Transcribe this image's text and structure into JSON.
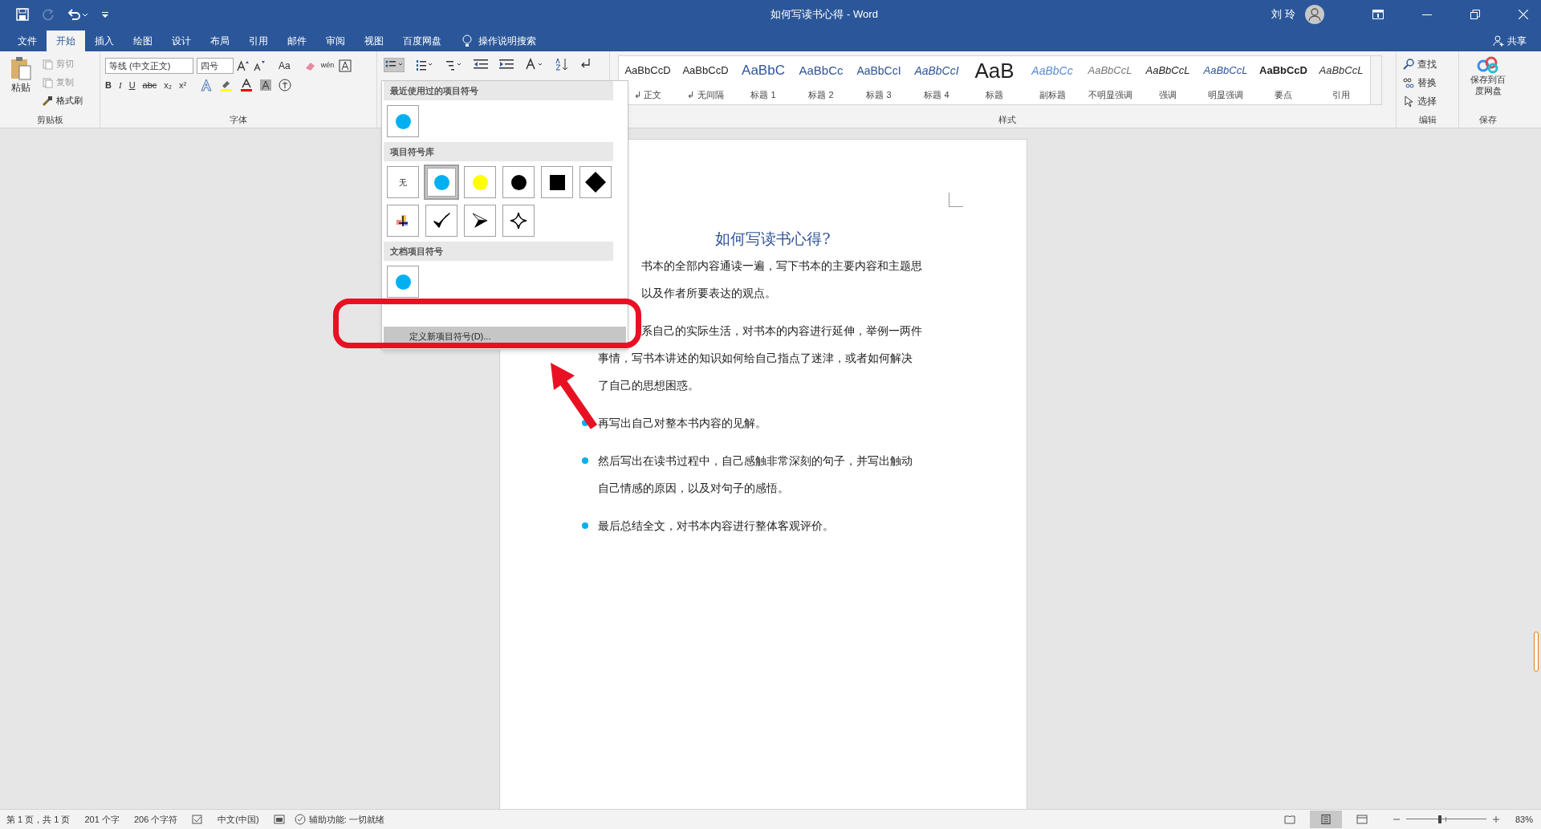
{
  "window": {
    "title": "如何写读书心得  -  Word",
    "user": "刘 玲"
  },
  "ribbon_tabs": [
    {
      "label": "文件",
      "selected": false
    },
    {
      "label": "开始",
      "selected": true
    },
    {
      "label": "插入",
      "selected": false
    },
    {
      "label": "绘图",
      "selected": false
    },
    {
      "label": "设计",
      "selected": false
    },
    {
      "label": "布局",
      "selected": false
    },
    {
      "label": "引用",
      "selected": false
    },
    {
      "label": "邮件",
      "selected": false
    },
    {
      "label": "审阅",
      "selected": false
    },
    {
      "label": "视图",
      "selected": false
    },
    {
      "label": "百度网盘",
      "selected": false
    }
  ],
  "tell_me": "操作说明搜索",
  "share": "共享",
  "clipboard": {
    "paste": "粘贴",
    "cut": "剪切",
    "copy": "复制",
    "format_painter": "格式刷",
    "group": "剪贴板"
  },
  "font": {
    "name": "等线 (中文正文)",
    "size": "四号",
    "case": "Aa",
    "phonetic": "wén",
    "format_buttons": [
      "B",
      "I",
      "U",
      "abc",
      "x₂",
      "x²"
    ],
    "group": "字体"
  },
  "styles": {
    "items": [
      {
        "preview": "AaBbCcD",
        "name": "↲ 正文"
      },
      {
        "preview": "AaBbCcD",
        "name": "↲ 无间隔"
      },
      {
        "preview": "AaBbC",
        "name": "标题 1"
      },
      {
        "preview": "AaBbCc",
        "name": "标题 2"
      },
      {
        "preview": "AaBbCcI",
        "name": "标题 3"
      },
      {
        "preview": "AaBbCcI",
        "name": "标题 4"
      },
      {
        "preview": "AaB",
        "name": "标题"
      },
      {
        "preview": "AaBbCc",
        "name": "副标题"
      },
      {
        "preview": "AaBbCcL",
        "name": "不明显强调"
      },
      {
        "preview": "AaBbCcL",
        "name": "强调"
      },
      {
        "preview": "AaBbCcL",
        "name": "明显强调"
      },
      {
        "preview": "AaBbCcD",
        "name": "要点"
      },
      {
        "preview": "AaBbCcL",
        "name": "引用"
      }
    ],
    "group": "样式"
  },
  "editing": {
    "find": "查找",
    "replace": "替换",
    "select": "选择",
    "group": "编辑"
  },
  "save": {
    "button": "保存到百度网盘",
    "group": "保存"
  },
  "bullet_menu": {
    "sections": [
      {
        "heading": "最近使用过的项目符号",
        "bullets": [
          {
            "kind": "disc",
            "color": "#00b0f0",
            "selected": false
          }
        ]
      },
      {
        "heading": "项目符号库",
        "bullets": [
          {
            "kind": "none",
            "label": "无",
            "selected": false
          },
          {
            "kind": "disc",
            "color": "#00b0f0",
            "selected": true
          },
          {
            "kind": "disc",
            "color": "#ffff00",
            "selected": false
          },
          {
            "kind": "disc",
            "color": "#000000",
            "selected": false
          },
          {
            "kind": "square",
            "selected": false
          },
          {
            "kind": "diamond",
            "selected": false
          },
          {
            "kind": "picture",
            "selected": false
          },
          {
            "kind": "check",
            "selected": false
          },
          {
            "kind": "arrowhead",
            "selected": false
          },
          {
            "kind": "star",
            "selected": false
          }
        ]
      },
      {
        "heading": "文档项目符号",
        "bullets": [
          {
            "kind": "disc",
            "color": "#00b0f0",
            "selected": false
          }
        ]
      }
    ],
    "define": "定义新项目符号(D)..."
  },
  "document": {
    "title": "如何写读书心得?",
    "paragraphs": [
      {
        "bulleted": false,
        "covered": true,
        "lines": [
          "书本的全部内容通读一遍，写下书本的主要内容和主题思",
          "以及作者所要表达的观点。"
        ]
      },
      {
        "bulleted": false,
        "covered_first": true,
        "lines": [
          "系自己的实际生活，对书本的内容进行延伸，举例一两件",
          "事情，写书本讲述的知识如何给自己指点了迷津，或者如何解决",
          "了自己的思想困惑。"
        ]
      },
      {
        "bulleted": true,
        "lines": [
          "再写出自己对整本书内容的见解。"
        ]
      },
      {
        "bulleted": true,
        "lines": [
          "然后写出在读书过程中，自己感触非常深刻的句子，并写出触动",
          "自己情感的原因，以及对句子的感悟。"
        ]
      },
      {
        "bulleted": true,
        "lines": [
          "最后总结全文，对书本内容进行整体客观评价。"
        ]
      }
    ]
  },
  "status_bar": {
    "page": "第 1 页，共 1 页",
    "words": "201 个字",
    "chars": "206 个字符",
    "language": "中文(中国)",
    "accessibility": "辅助功能: 一切就绪",
    "zoom": "83%",
    "zoom_slider": {
      "level": 0.42
    }
  }
}
